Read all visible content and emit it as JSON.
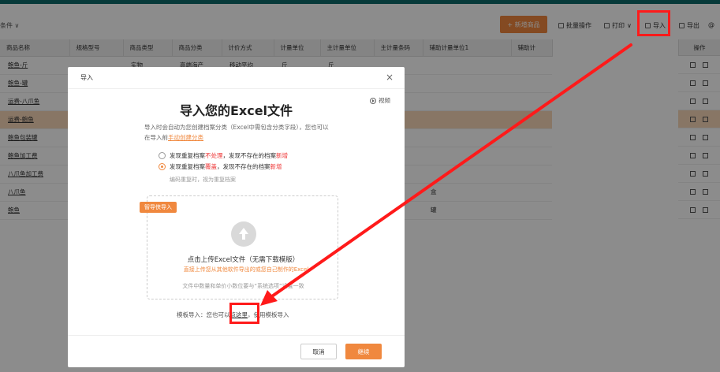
{
  "toolbar": {
    "condition_label": "条件 ∨",
    "new_button": "+ 新增商品",
    "batch_label": "批量操作",
    "print_label": "打印",
    "import_label": "导入",
    "export_label": "导出",
    "more_label": "@"
  },
  "table": {
    "headers": [
      "商品名称",
      "规格型号",
      "商品类型",
      "商品分类",
      "计价方式",
      "计量单位",
      "主计量单位",
      "主计量条码",
      "辅助计量单位1",
      "辅助计"
    ],
    "rows": [
      [
        "鲍鱼-斤",
        "",
        "实物",
        "高端海产",
        "移动平均",
        "斤",
        "斤",
        "",
        "",
        ""
      ],
      [
        "鲍鱼-罐",
        "",
        "",
        "",
        "",
        "",
        "",
        "",
        "",
        ""
      ],
      [
        "运费-八爪鱼",
        "",
        "",
        "",
        "",
        "",
        "",
        "",
        "",
        ""
      ],
      [
        "运费-鲍鱼",
        "",
        "",
        "",
        "",
        "",
        "",
        "",
        "",
        ""
      ],
      [
        "鲍鱼包装罐",
        "",
        "",
        "",
        "",
        "",
        "",
        "",
        "",
        ""
      ],
      [
        "鲍鱼加工费",
        "",
        "",
        "",
        "",
        "",
        "",
        "",
        "",
        ""
      ],
      [
        "八爪鱼加工费",
        "",
        "",
        "",
        "",
        "",
        "",
        "",
        "",
        ""
      ],
      [
        "八爪鱼",
        "",
        "",
        "",
        "",
        "",
        "",
        "",
        "盒",
        ""
      ],
      [
        "鲍鱼",
        "",
        "",
        "",
        "",
        "",
        "",
        "",
        "罐",
        ""
      ]
    ],
    "op_header": "操作"
  },
  "modal": {
    "header": "导入",
    "close": "×",
    "title": "导入您的Excel文件",
    "video": "视频",
    "desc_1": "导入时会自动为您创建档案分类（Excel中需包含分类字段），您也可以",
    "desc_2_prefix": "在导入前",
    "desc_2_link": "手动创建分类",
    "option1_prefix": "发现重复档案",
    "option1_em": "不处理",
    "option1_mid": "，发现不存在的档案",
    "option1_em2": "新增",
    "option2_prefix": "发现重复档案",
    "option2_em": "覆盖",
    "option2_mid": "，发现不存在的档案",
    "option2_em2": "新增",
    "hint": "编码重复时，视为重复档案",
    "tag": "智导侠导入",
    "upload_main": "点击上传Excel文件（无需下载模版）",
    "upload_sub": "直接上传您从其他软件导出的或您自己制作的Excel",
    "upload_note": "文件中数量和单价小数位要与“系统选项”设置一致",
    "tpl_prefix": "模板导入：您也可以",
    "tpl_link": "点这里",
    "tpl_suffix": "，使用模板导入",
    "cancel": "取消",
    "continue": "继续"
  },
  "colors": {
    "accent": "#f0883e",
    "highlight": "#ff1a1a",
    "topbar": "#0e6b6b"
  },
  "icons": [
    "chevron-down-icon",
    "edit-icon",
    "copy-icon",
    "play-icon",
    "upload-icon",
    "close-icon"
  ]
}
